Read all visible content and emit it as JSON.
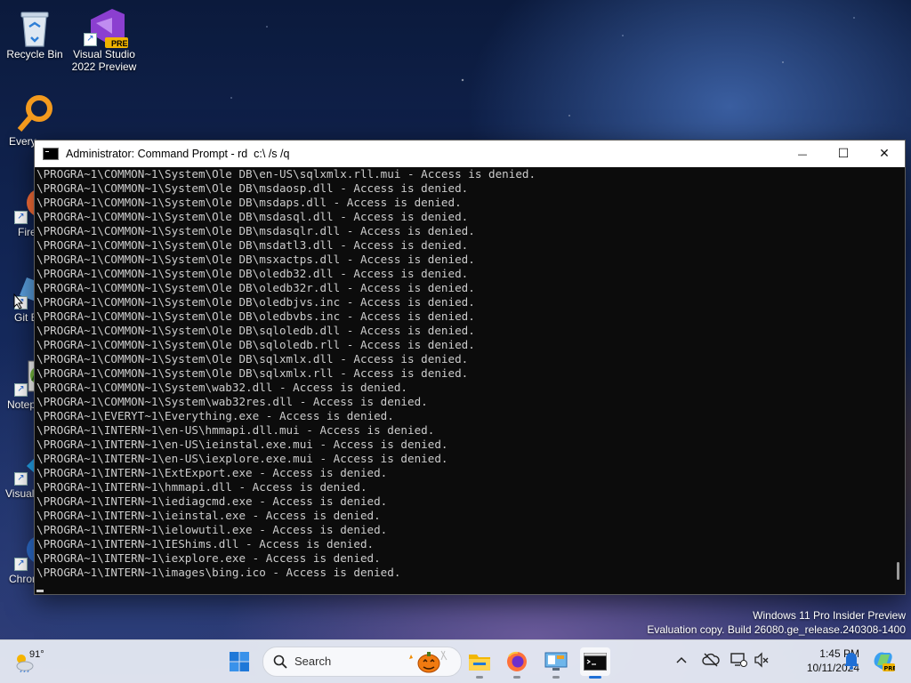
{
  "desktop": {
    "icons": [
      {
        "label": "Recycle Bin",
        "icon": "recycle-bin-icon"
      },
      {
        "label": "Visual Studio 2022 Preview",
        "icon": "visual-studio-preview-icon",
        "badge": "PRE"
      },
      {
        "label": "Every",
        "icon": "everything-search-icon"
      },
      {
        "label": "Fire",
        "icon": "firefox-icon"
      },
      {
        "label": "Git B",
        "icon": "git-bash-icon"
      },
      {
        "label": "Notep",
        "icon": "notepad-plus-plus-icon"
      },
      {
        "label": "Visual Co",
        "icon": "vscode-icon"
      },
      {
        "label": "Chron",
        "icon": "chrome-canary-icon"
      }
    ]
  },
  "window": {
    "title": "Administrator: Command Prompt - rd  c:\\ /s /q",
    "minimize_glyph": "—",
    "maximize_glyph": "☐",
    "close_glyph": "✕",
    "lines": [
      "\\PROGRA~1\\COMMON~1\\System\\Ole DB\\en-US\\sqlxmlx.rll.mui - Access is denied.",
      "\\PROGRA~1\\COMMON~1\\System\\Ole DB\\msdaosp.dll - Access is denied.",
      "\\PROGRA~1\\COMMON~1\\System\\Ole DB\\msdaps.dll - Access is denied.",
      "\\PROGRA~1\\COMMON~1\\System\\Ole DB\\msdasql.dll - Access is denied.",
      "\\PROGRA~1\\COMMON~1\\System\\Ole DB\\msdasqlr.dll - Access is denied.",
      "\\PROGRA~1\\COMMON~1\\System\\Ole DB\\msdatl3.dll - Access is denied.",
      "\\PROGRA~1\\COMMON~1\\System\\Ole DB\\msxactps.dll - Access is denied.",
      "\\PROGRA~1\\COMMON~1\\System\\Ole DB\\oledb32.dll - Access is denied.",
      "\\PROGRA~1\\COMMON~1\\System\\Ole DB\\oledb32r.dll - Access is denied.",
      "\\PROGRA~1\\COMMON~1\\System\\Ole DB\\oledbjvs.inc - Access is denied.",
      "\\PROGRA~1\\COMMON~1\\System\\Ole DB\\oledbvbs.inc - Access is denied.",
      "\\PROGRA~1\\COMMON~1\\System\\Ole DB\\sqloledb.dll - Access is denied.",
      "\\PROGRA~1\\COMMON~1\\System\\Ole DB\\sqloledb.rll - Access is denied.",
      "\\PROGRA~1\\COMMON~1\\System\\Ole DB\\sqlxmlx.dll - Access is denied.",
      "\\PROGRA~1\\COMMON~1\\System\\Ole DB\\sqlxmlx.rll - Access is denied.",
      "\\PROGRA~1\\COMMON~1\\System\\wab32.dll - Access is denied.",
      "\\PROGRA~1\\COMMON~1\\System\\wab32res.dll - Access is denied.",
      "\\PROGRA~1\\EVERYT~1\\Everything.exe - Access is denied.",
      "\\PROGRA~1\\INTERN~1\\en-US\\hmmapi.dll.mui - Access is denied.",
      "\\PROGRA~1\\INTERN~1\\en-US\\ieinstal.exe.mui - Access is denied.",
      "\\PROGRA~1\\INTERN~1\\en-US\\iexplore.exe.mui - Access is denied.",
      "\\PROGRA~1\\INTERN~1\\ExtExport.exe - Access is denied.",
      "\\PROGRA~1\\INTERN~1\\hmmapi.dll - Access is denied.",
      "\\PROGRA~1\\INTERN~1\\iediagcmd.exe - Access is denied.",
      "\\PROGRA~1\\INTERN~1\\ieinstal.exe - Access is denied.",
      "\\PROGRA~1\\INTERN~1\\ielowutil.exe - Access is denied.",
      "\\PROGRA~1\\INTERN~1\\IEShims.dll - Access is denied.",
      "\\PROGRA~1\\INTERN~1\\iexplore.exe - Access is denied.",
      "\\PROGRA~1\\INTERN~1\\images\\bing.ico - Access is denied."
    ]
  },
  "watermark": {
    "line1": "Windows 11 Pro Insider Preview",
    "line2": "Evaluation copy. Build 26080.ge_release.240308-1400"
  },
  "taskbar": {
    "weather": {
      "temp": "91°",
      "icon": "weather-sun-cloud-icon"
    },
    "search_label": "Search",
    "apps": [
      {
        "name": "start-button",
        "icon": "windows-start-icon"
      },
      {
        "name": "file-explorer",
        "icon": "folder-icon"
      },
      {
        "name": "firefox",
        "icon": "firefox-icon"
      },
      {
        "name": "control-panel",
        "icon": "control-panel-icon"
      },
      {
        "name": "command-prompt",
        "icon": "terminal-icon",
        "active": true
      }
    ],
    "clock": {
      "time": "1:45 PM",
      "date": "10/11/2024"
    }
  },
  "colors": {
    "console_bg": "#0c0c0c",
    "console_fg": "#cccccc",
    "accent": "#1f6fd6"
  }
}
